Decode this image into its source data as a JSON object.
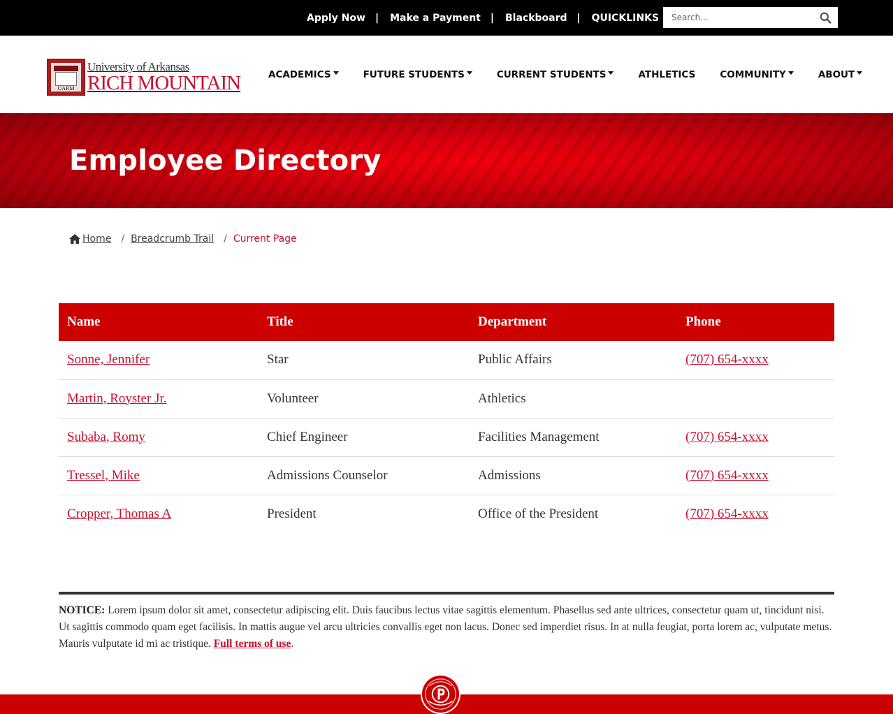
{
  "topbar": {
    "links": [
      "Apply Now",
      "Make a Payment",
      "Blackboard",
      "QUICKLINKS"
    ],
    "separator": "|",
    "search_placeholder": "Search..."
  },
  "logo": {
    "line1": "University of Arkansas",
    "line2": "RICH MOUNTAIN",
    "mark_text": "UARM"
  },
  "nav": {
    "items": [
      {
        "label": "ACADEMICS",
        "dropdown": true
      },
      {
        "label": "FUTURE STUDENTS",
        "dropdown": true
      },
      {
        "label": "CURRENT STUDENTS",
        "dropdown": true
      },
      {
        "label": "ATHLETICS",
        "dropdown": false
      },
      {
        "label": "COMMUNITY",
        "dropdown": true
      },
      {
        "label": "ABOUT",
        "dropdown": true
      }
    ]
  },
  "hero": {
    "title": "Employee Directory"
  },
  "breadcrumb": {
    "home": "Home",
    "trail": "Breadcrumb Trail",
    "current": "Current Page",
    "separator": "/"
  },
  "table": {
    "headers": [
      "Name",
      "Title",
      "Department",
      "Phone"
    ],
    "rows": [
      {
        "name": "Sonne, Jennifer",
        "title": "Star",
        "department": "Public Affairs",
        "phone": "(707) 654-xxxx"
      },
      {
        "name": "Martin, Royster Jr.",
        "title": "Volunteer",
        "department": "Athletics",
        "phone": ""
      },
      {
        "name": "Subaba, Romy",
        "title": "Chief Engineer",
        "department": "Facilities Management",
        "phone": "(707) 654-xxxx"
      },
      {
        "name": "Tressel, Mike",
        "title": "Admissions Counselor",
        "department": "Admissions",
        "phone": "(707) 654-xxxx"
      },
      {
        "name": "Cropper, Thomas A",
        "title": "President",
        "department": "Office of the President",
        "phone": "(707) 654-xxxx"
      }
    ]
  },
  "notice": {
    "label": "NOTICE:",
    "text": "Lorem ipsum dolor sit amet, consectetur adipiscing elit. Duis faucibus lectus vitae sagittis elementum. Phasellus sed ante ultrices, consectetur quam ut, tincidunt nisi. Ut sagittis commodo quam eget facilisis. In mattis augue vel arcu ultricies convallis eget non lacus. Donec sed imperdiet risus. In at nulla feugiat, porta lorem ac, vulputate metus. Mauris vulputate id mi ac tristique.",
    "link": "Full terms of use",
    "end": "."
  },
  "colors": {
    "brand_red": "#cc0000",
    "link_red": "#c8102e",
    "topbar_bg": "#000000"
  },
  "icons": {
    "search": "search-icon",
    "home": "home-icon",
    "seal": "university-seal-icon"
  }
}
